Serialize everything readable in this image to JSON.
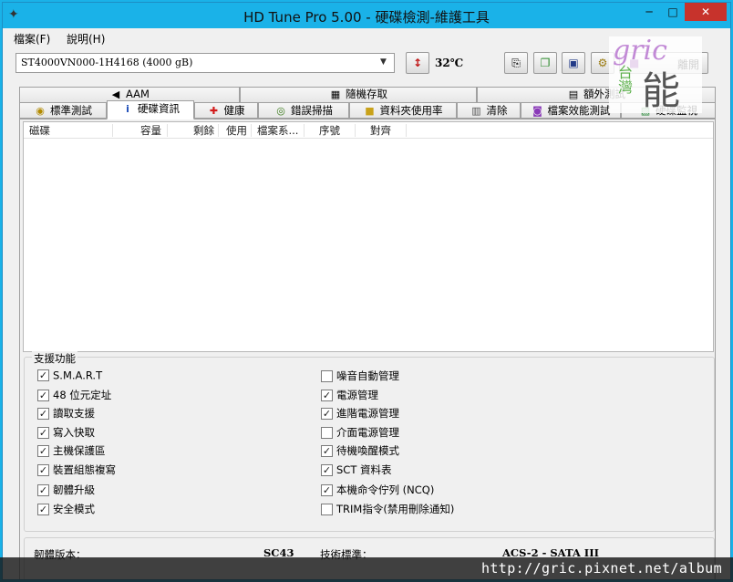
{
  "window": {
    "title": "HD Tune Pro  5.00 - 硬碟檢測-維護工具",
    "controls": {
      "minimize": "─",
      "maximize": "□",
      "close": "✕"
    },
    "icon": "app-icon"
  },
  "menu": [
    "檔案(F)",
    "說明(H)"
  ],
  "toolbar": {
    "drive": "ST4000VN000-1H4168 (4000 gB)",
    "temperature": "32℃",
    "exit_label": "離開",
    "icons": [
      "thermometer-icon",
      "copy-text-icon",
      "copy-screenshot-icon",
      "save-icon",
      "options-icon",
      "exit-icon"
    ]
  },
  "tabs_row1": [
    {
      "label": "AAM",
      "icon": "speaker-icon"
    },
    {
      "label": "隨機存取",
      "icon": "random-access-icon"
    },
    {
      "label": "額外測試",
      "icon": "extra-tests-icon"
    }
  ],
  "tabs_row2": [
    {
      "label": "標準測試",
      "icon": "bulb-icon"
    },
    {
      "label": "硬碟資訊",
      "icon": "info-icon",
      "active": true
    },
    {
      "label": "健康",
      "icon": "health-cross-icon"
    },
    {
      "label": "錯誤掃描",
      "icon": "magnifier-icon"
    },
    {
      "label": "資料夾使用率",
      "icon": "folder-icon"
    },
    {
      "label": "清除",
      "icon": "trash-icon"
    },
    {
      "label": "檔案效能測試",
      "icon": "file-benchmark-icon"
    },
    {
      "label": "硬碟監視",
      "icon": "monitor-icon"
    }
  ],
  "list_columns": [
    "磁碟",
    "容量",
    "剩餘",
    "使用",
    "檔案系...",
    "序號",
    "對齊"
  ],
  "features": {
    "legend": "支援功能",
    "left": [
      {
        "label": "S.M.A.R.T",
        "checked": true
      },
      {
        "label": "48 位元定址",
        "checked": true
      },
      {
        "label": "讀取支援",
        "checked": true
      },
      {
        "label": "寫入快取",
        "checked": true
      },
      {
        "label": "主機保護區",
        "checked": true
      },
      {
        "label": "裝置組態複寫",
        "checked": true
      },
      {
        "label": "韌體升級",
        "checked": true
      },
      {
        "label": "安全模式",
        "checked": true
      }
    ],
    "right": [
      {
        "label": "噪音自動管理",
        "checked": false
      },
      {
        "label": "電源管理",
        "checked": true
      },
      {
        "label": "進階電源管理",
        "checked": true
      },
      {
        "label": "介面電源管理",
        "checked": false
      },
      {
        "label": "待機喚醒模式",
        "checked": true
      },
      {
        "label": "SCT 資料表",
        "checked": true
      },
      {
        "label": "本機命令佇列 (NCQ)",
        "checked": true
      },
      {
        "label": "TRIM指令(禁用刪除通知)",
        "checked": false
      }
    ]
  },
  "info": {
    "firmware_label": "韌體版本：",
    "firmware_value": "SC43",
    "standard_label": "技術標準：",
    "standard_value": "ACS-2 - SATA III"
  },
  "watermark": {
    "script": "gric",
    "char_big": "能",
    "char_small": "台灣"
  },
  "url": "http://gric.pixnet.net/album"
}
